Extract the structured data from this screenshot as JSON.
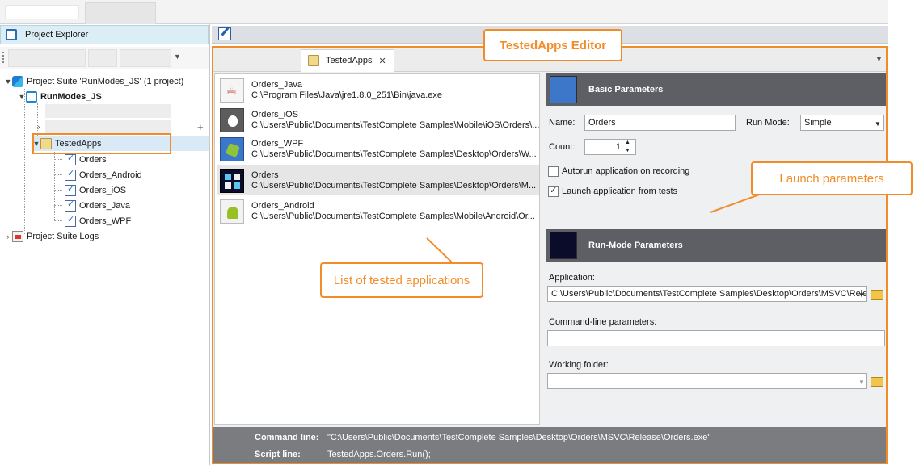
{
  "left_panel": {
    "title": "Project Explorer",
    "tree": {
      "suite": "Project Suite 'RunModes_JS' (1 project)",
      "project": "RunModes_JS",
      "tested_apps": "TestedApps",
      "apps": [
        "Orders",
        "Orders_Android",
        "Orders_iOS",
        "Orders_Java",
        "Orders_WPF"
      ],
      "logs": "Project Suite Logs"
    }
  },
  "editor": {
    "tab_label": "TestedApps",
    "tab_close": "✕",
    "app_list": [
      {
        "name": "Orders_Java",
        "path": "C:\\Program Files\\Java\\jre1.8.0_251\\Bin\\java.exe"
      },
      {
        "name": "Orders_iOS",
        "path": "C:\\Users\\Public\\Documents\\TestComplete Samples\\Mobile\\iOS\\Orders\\..."
      },
      {
        "name": "Orders_WPF",
        "path": "C:\\Users\\Public\\Documents\\TestComplete Samples\\Desktop\\Orders\\W..."
      },
      {
        "name": "Orders",
        "path": "C:\\Users\\Public\\Documents\\TestComplete Samples\\Desktop\\Orders\\M..."
      },
      {
        "name": "Orders_Android",
        "path": "C:\\Users\\Public\\Documents\\TestComplete Samples\\Mobile\\Android\\Or..."
      }
    ],
    "basic": {
      "header": "Basic Parameters",
      "name_label": "Name:",
      "name_value": "Orders",
      "run_mode_label": "Run Mode:",
      "run_mode_value": "Simple",
      "count_label": "Count:",
      "count_value": "1",
      "autorun_label": "Autorun application on recording",
      "autorun_checked": false,
      "launch_label": "Launch application from tests",
      "launch_checked": true
    },
    "runmode": {
      "header": "Run-Mode Parameters",
      "application_label": "Application:",
      "application_value": "C:\\Users\\Public\\Documents\\TestComplete Samples\\Desktop\\Orders\\MSVC\\Rele",
      "cmdline_label": "Command-line parameters:",
      "cmdline_value": "",
      "workdir_label": "Working folder:",
      "workdir_value": ""
    },
    "status": {
      "command_label": "Command line:",
      "command_value": "\"C:\\Users\\Public\\Documents\\TestComplete Samples\\Desktop\\Orders\\MSVC\\Release\\Orders.exe\"",
      "script_label": "Script line:",
      "script_value": "TestedApps.Orders.Run();"
    }
  },
  "callouts": {
    "editor": "TestedApps Editor",
    "list": "List of tested applications",
    "launch": "Launch parameters"
  },
  "colors": {
    "accent": "#f28c28",
    "header_dark": "#5d5f64",
    "explorer_header": "#dbeef5",
    "selection": "#d9e9f6"
  }
}
